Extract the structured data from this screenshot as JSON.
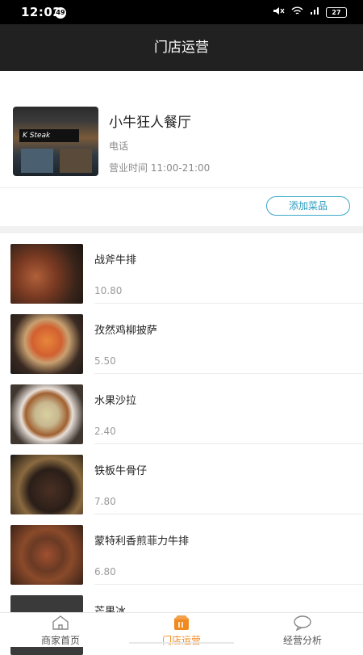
{
  "status_bar": {
    "time": "12:02",
    "notification_count": "49",
    "battery": "27"
  },
  "header": {
    "title": "门店运营"
  },
  "shop": {
    "name": "小牛狂人餐厅",
    "phone_label": "电话",
    "hours": "营业时间 11:00-21:00",
    "sign_text": "K Steak"
  },
  "actions": {
    "add_dish": "添加菜品"
  },
  "dishes": [
    {
      "name": "战斧牛排",
      "price": "10.80"
    },
    {
      "name": "孜然鸡柳披萨",
      "price": "5.50"
    },
    {
      "name": "水果沙拉",
      "price": "2.40"
    },
    {
      "name": "铁板牛骨仔",
      "price": "7.80"
    },
    {
      "name": "蒙特利香煎菲力牛排",
      "price": "6.80"
    },
    {
      "name": "芒果冰",
      "price": ""
    }
  ],
  "tabs": [
    {
      "label": "商家首页",
      "icon": "home-icon"
    },
    {
      "label": "门店运营",
      "icon": "store-icon"
    },
    {
      "label": "经营分析",
      "icon": "chat-bubble-icon"
    }
  ],
  "colors": {
    "accent": "#f08a1e",
    "button_border": "#3aa9c9",
    "header_bg": "#212121"
  }
}
